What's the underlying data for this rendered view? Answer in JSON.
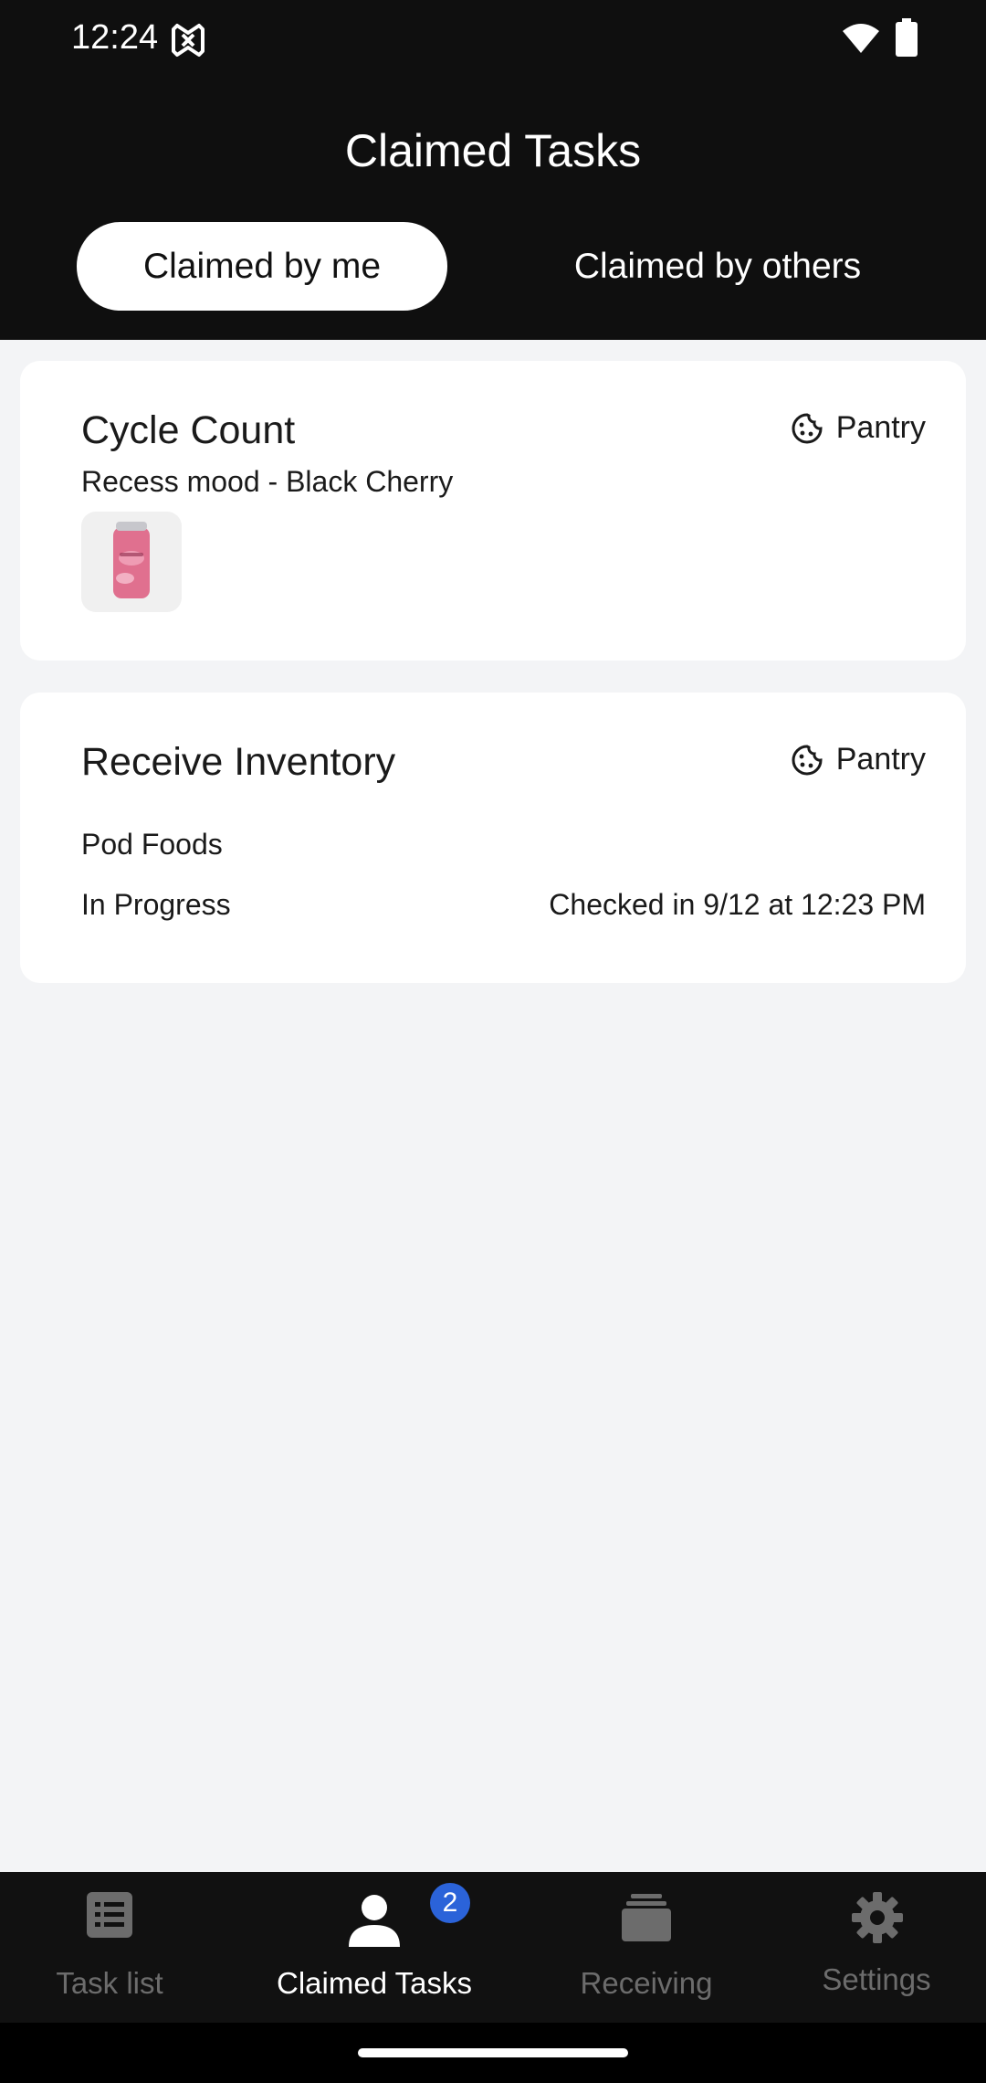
{
  "status_bar": {
    "time": "12:24",
    "app_icon": "hexagon-link-icon",
    "wifi_icon": "wifi-icon",
    "battery_icon": "battery-icon"
  },
  "header": {
    "title": "Claimed Tasks",
    "tabs": [
      {
        "label": "Claimed by me",
        "active": true
      },
      {
        "label": "Claimed by others",
        "active": false
      }
    ]
  },
  "tasks": [
    {
      "title": "Cycle Count",
      "location": "Pantry",
      "location_icon": "cookie-icon",
      "subtitle": "Recess mood - Black Cherry",
      "thumbnail": "soda-can-image"
    },
    {
      "title": "Receive Inventory",
      "location": "Pantry",
      "location_icon": "cookie-icon",
      "vendor": "Pod Foods",
      "status": "In Progress",
      "checked_in": "Checked in 9/12 at 12:23 PM"
    }
  ],
  "bottom_nav": {
    "items": [
      {
        "label": "Task list",
        "icon": "list-icon",
        "active": false
      },
      {
        "label": "Claimed Tasks",
        "icon": "person-icon",
        "active": true,
        "badge": "2"
      },
      {
        "label": "Receiving",
        "icon": "stack-icon",
        "active": false
      },
      {
        "label": "Settings",
        "icon": "gear-icon",
        "active": false
      }
    ]
  },
  "colors": {
    "header_bg": "#0f0f0f",
    "page_bg": "#f3f4f6",
    "badge": "#2b63d9"
  }
}
